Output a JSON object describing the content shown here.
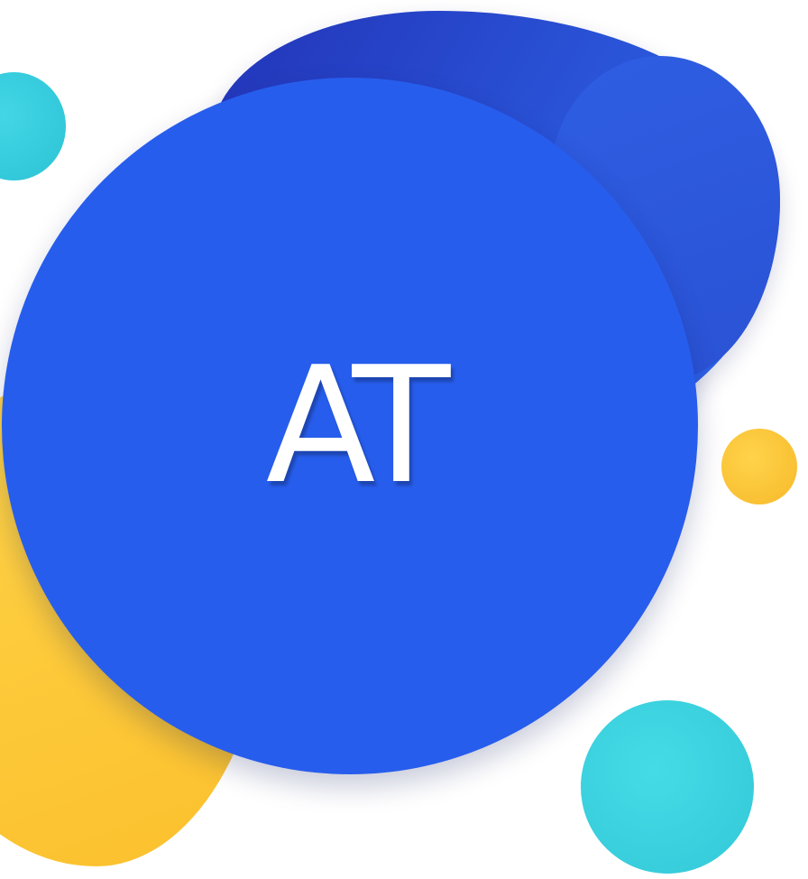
{
  "avatar": {
    "initials": "AT",
    "colors": {
      "main_circle": "#275dec",
      "navy_blob": "#2a55d9",
      "yellow": "#fbc02d",
      "teal": "#33c8d8",
      "text": "#ffffff",
      "background": "#ffffff"
    }
  }
}
